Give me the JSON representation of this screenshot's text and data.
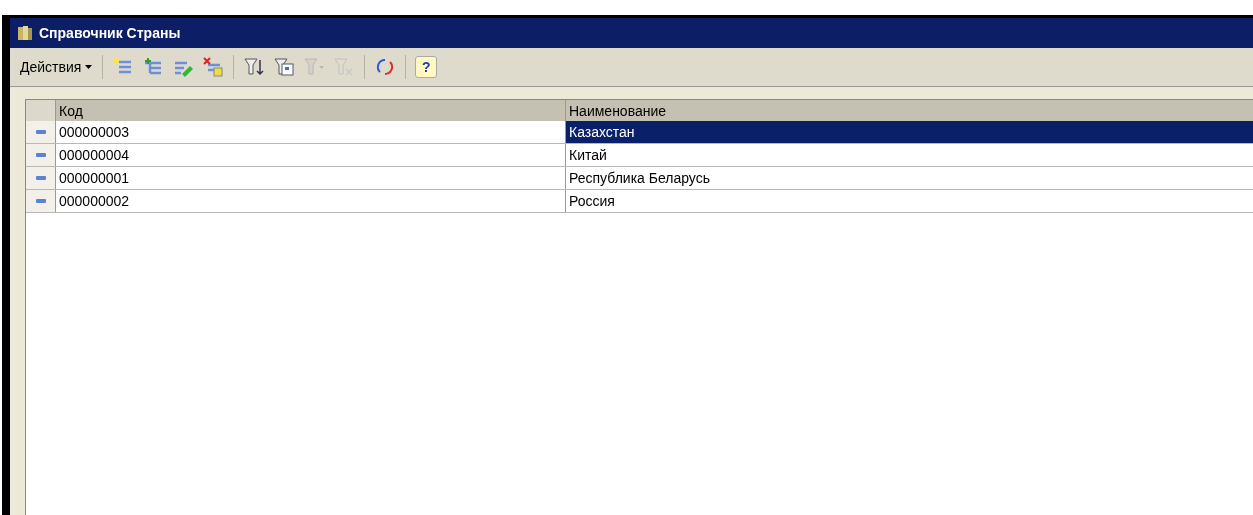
{
  "window": {
    "title": "Справочник Страны"
  },
  "toolbar": {
    "actions_menu": "Действия",
    "buttons": [
      {
        "kind": "add",
        "disabled": false
      },
      {
        "kind": "add-child",
        "disabled": false
      },
      {
        "kind": "edit",
        "disabled": false
      },
      {
        "kind": "delete",
        "disabled": false
      },
      {
        "kind": "separator"
      },
      {
        "kind": "filter-sort",
        "disabled": false
      },
      {
        "kind": "filter-doc",
        "disabled": false
      },
      {
        "kind": "filter-menu",
        "disabled": true
      },
      {
        "kind": "filter-clear",
        "disabled": true
      },
      {
        "kind": "separator"
      },
      {
        "kind": "refresh",
        "disabled": false
      },
      {
        "kind": "separator"
      },
      {
        "kind": "help",
        "disabled": false,
        "label": "?"
      }
    ]
  },
  "table": {
    "columns": [
      "Код",
      "Наименование"
    ],
    "rows": [
      {
        "code": "000000003",
        "name": "Казахстан",
        "selected": true
      },
      {
        "code": "000000004",
        "name": "Китай",
        "selected": false
      },
      {
        "code": "000000001",
        "name": "Республика Беларусь",
        "selected": false
      },
      {
        "code": "000000002",
        "name": "Россия",
        "selected": false
      }
    ]
  }
}
